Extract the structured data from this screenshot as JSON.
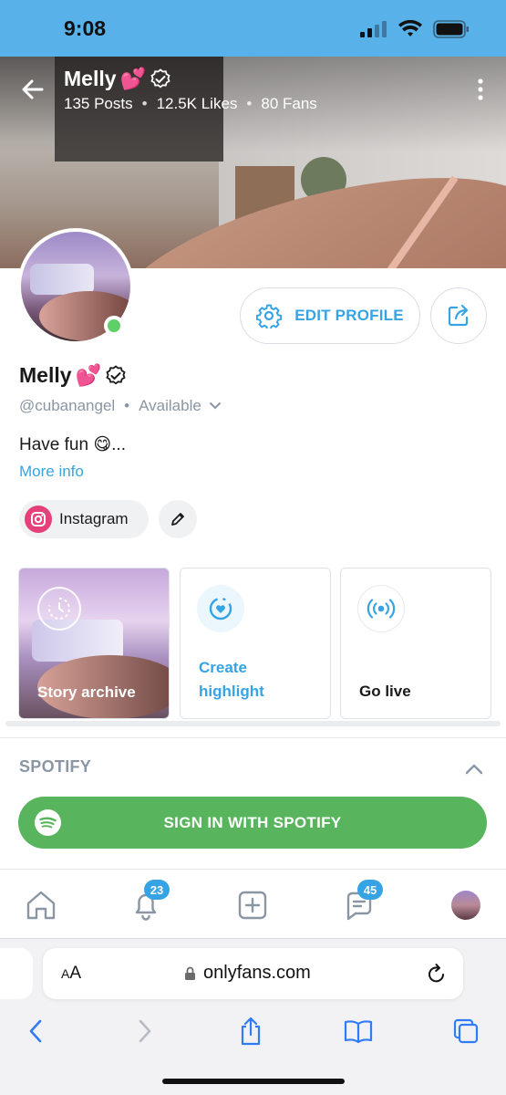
{
  "status_bar": {
    "time": "9:08"
  },
  "header": {
    "name": "Melly",
    "emoji": "💕",
    "stats": {
      "posts": "135 Posts",
      "likes": "12.5K Likes",
      "fans": "80 Fans"
    },
    "separator": "•"
  },
  "profile": {
    "name": "Melly",
    "emoji": "💕",
    "handle": "@cubanangel",
    "separator": "•",
    "availability": "Available",
    "bio": "Have fun 😋...",
    "more_info": "More info",
    "edit_profile_label": "EDIT PROFILE",
    "social": {
      "instagram_label": "Instagram"
    }
  },
  "stories": {
    "archive_label": "Story archive",
    "create_highlight_label": "Create\nhighlight",
    "go_live_label": "Go live"
  },
  "spotify": {
    "section_title": "SPOTIFY",
    "sign_in_label": "SIGN IN WITH SPOTIFY"
  },
  "bottom_nav": {
    "notifications_count": "23",
    "messages_count": "45"
  },
  "browser": {
    "aa_label_small": "A",
    "aa_label_big": "A",
    "url": "onlyfans.com"
  },
  "colors": {
    "accent": "#36a3e5",
    "status_bar": "#58b1e8",
    "spotify_green": "#59b55d",
    "online": "#5fcf67",
    "instagram": "#e4407a"
  }
}
